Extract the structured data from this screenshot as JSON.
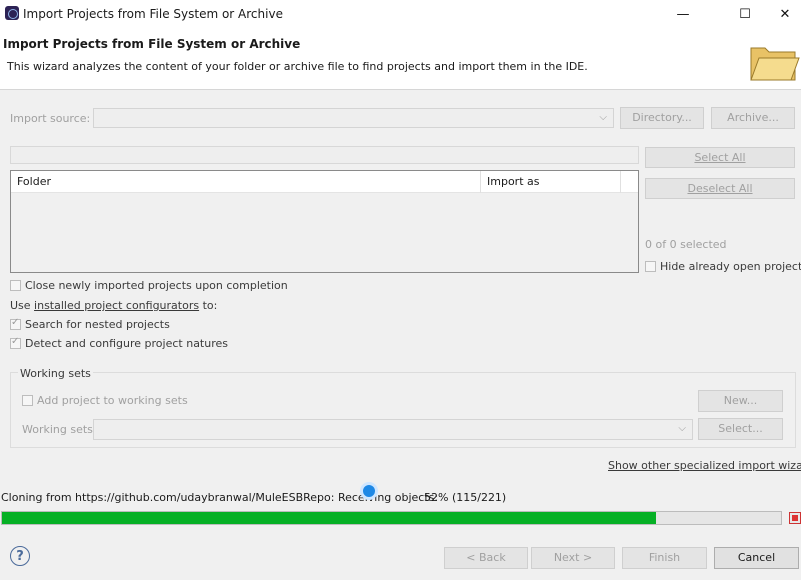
{
  "window": {
    "title": "Import Projects from File System or Archive",
    "controls": {
      "minimize": "—",
      "maximize": "☐",
      "close": "✕"
    }
  },
  "banner": {
    "title": "Import Projects from File System or Archive",
    "description": "This wizard analyzes the content of your folder or archive file to find projects and import them in the IDE."
  },
  "import_source": {
    "label": "Import source:",
    "value": "",
    "directory_button": "Directory...",
    "archive_button": "Archive..."
  },
  "filter": {
    "value": ""
  },
  "table": {
    "columns": [
      "Folder",
      "Import as"
    ],
    "rows": []
  },
  "selection": {
    "select_all": "Select All",
    "deselect_all": "Deselect All",
    "count": "0 of 0 selected",
    "hide_open": "Hide already open projects"
  },
  "options": {
    "close_imported": "Close newly imported projects upon completion",
    "use_prefix": "Use ",
    "configurators_link": "installed project configurators",
    "use_suffix": " to:",
    "search_nested": "Search for nested projects",
    "detect_natures": "Detect and configure project natures"
  },
  "working_sets": {
    "title": "Working sets",
    "add_label": "Add project to working sets",
    "new_button": "New...",
    "sets_label": "Working sets:",
    "select_button": "Select..."
  },
  "specialized_link": "Show other specialized import wizards",
  "progress": {
    "status": "Cloning from https://github.com/udaybranwal/MuleESBRepo: Receiving objects:",
    "percent_text": "52% (115/221)",
    "fraction": 0.84
  },
  "footer": {
    "back": "< Back",
    "next": "Next >",
    "finish": "Finish",
    "cancel": "Cancel",
    "help": "?"
  },
  "colors": {
    "progress": "#06b025",
    "stop": "#dd3333"
  }
}
